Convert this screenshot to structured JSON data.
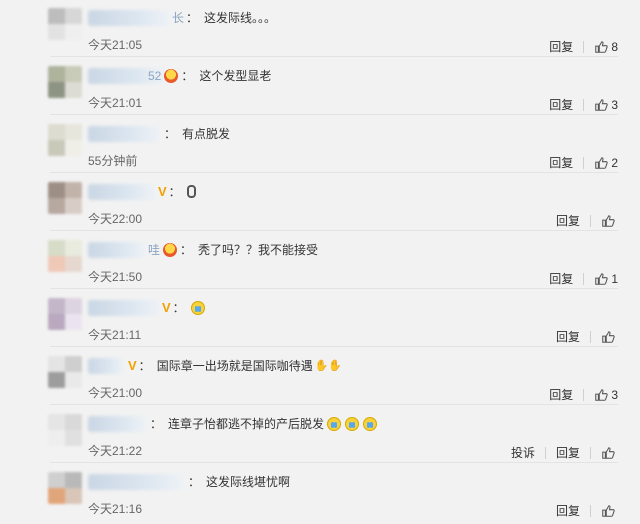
{
  "actions": {
    "reply": "回复",
    "report": "投诉"
  },
  "comments": [
    {
      "user_fragment": "长",
      "text": "这发际线。。。",
      "time": "今天21:05",
      "likes": "8"
    },
    {
      "user_fragment": "52",
      "text": "这个发型显老",
      "time": "今天21:01",
      "likes": "3"
    },
    {
      "user_fragment": "",
      "text": "有点脱发",
      "time": "55分钟前",
      "likes": "2"
    },
    {
      "user_fragment": "",
      "text": "",
      "time": "今天22:00",
      "likes": ""
    },
    {
      "user_fragment": "哇",
      "text": "秃了吗？？我不能接受",
      "time": "今天21:50",
      "likes": "1"
    },
    {
      "user_fragment": "",
      "text": "",
      "time": "今天21:11",
      "likes": ""
    },
    {
      "user_fragment": "",
      "text": "国际章一出场就是国际咖待遇",
      "time": "今天21:00",
      "likes": "3"
    },
    {
      "user_fragment": "",
      "text": "连章子怡都逃不掉的产后脱发",
      "time": "今天21:22",
      "likes": ""
    },
    {
      "user_fragment": "",
      "text": "这发际线堪忧啊",
      "time": "今天21:16",
      "likes": ""
    }
  ]
}
